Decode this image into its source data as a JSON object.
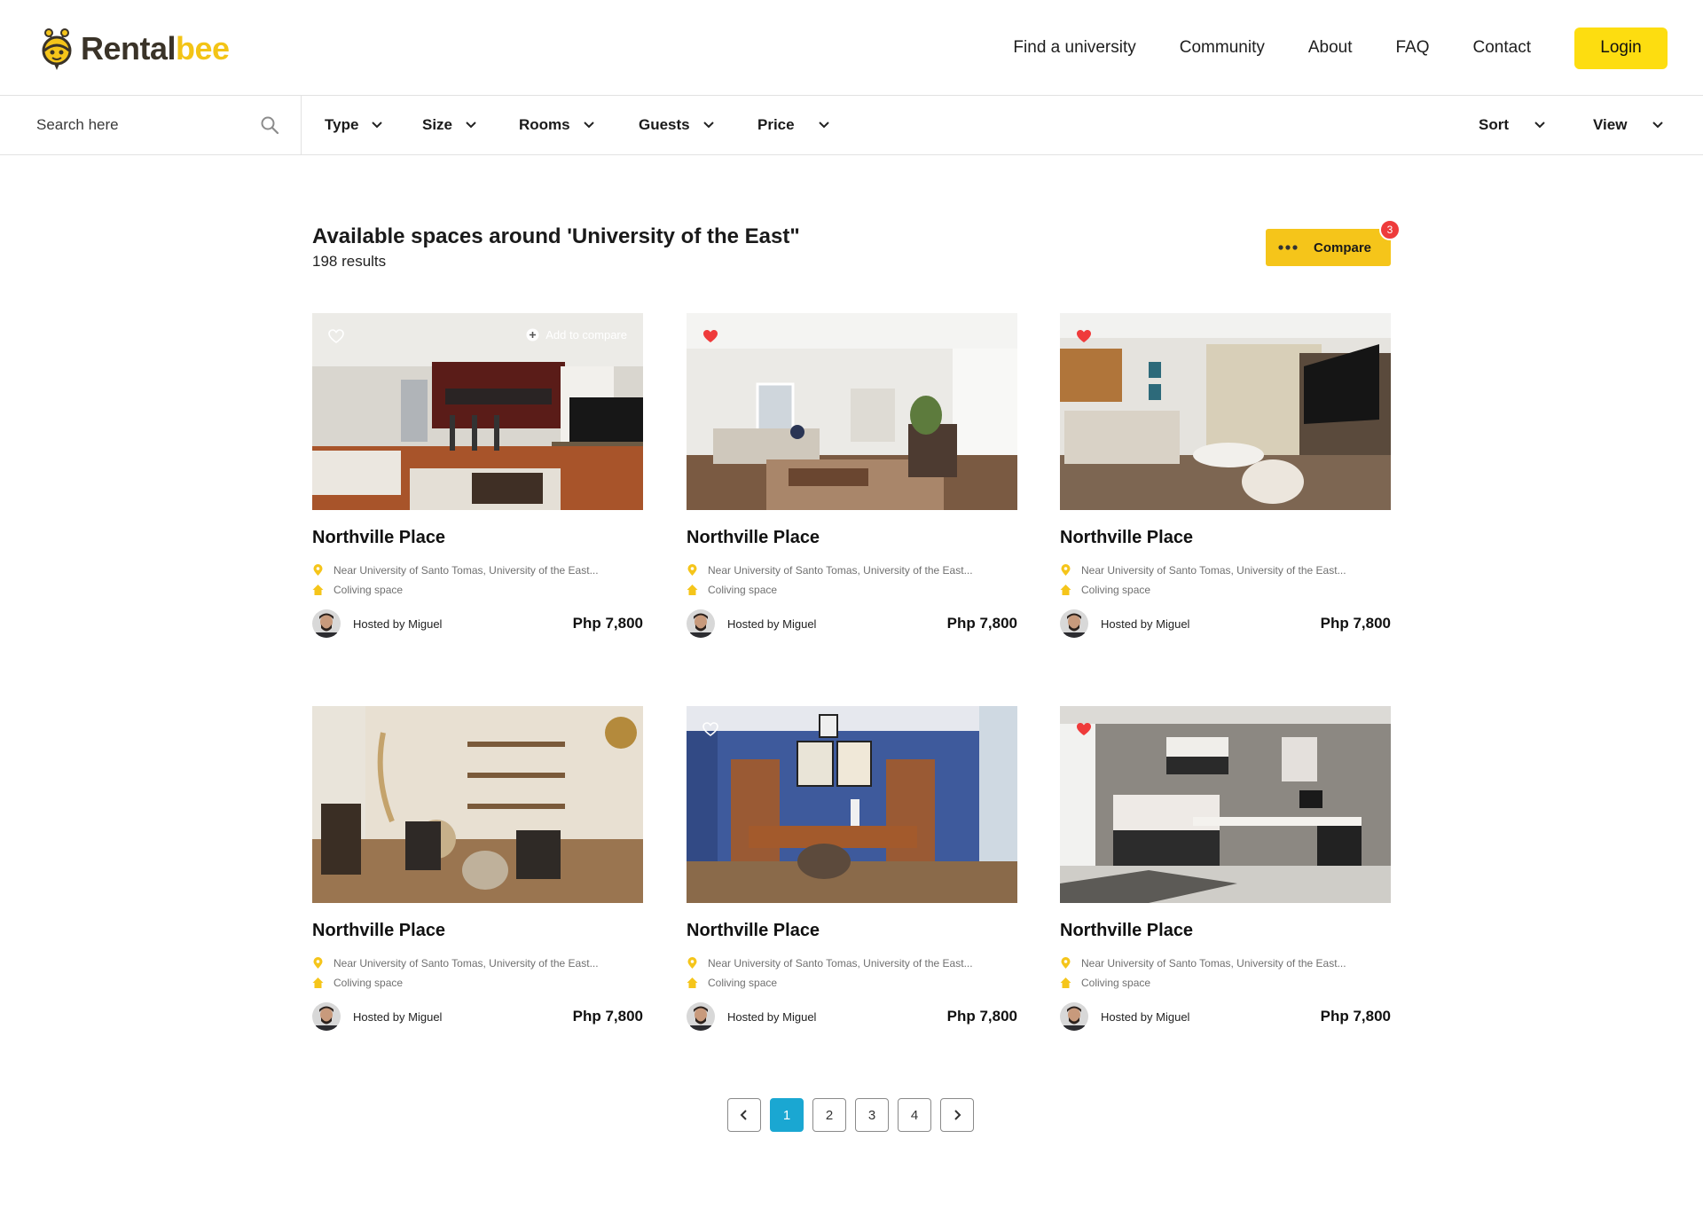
{
  "brand": {
    "name_part1": "Rental",
    "name_part2": "bee",
    "accent_color": "#fddd10"
  },
  "nav": {
    "links": [
      "Find a university",
      "Community",
      "About",
      "FAQ",
      "Contact"
    ],
    "login_label": "Login"
  },
  "filters": {
    "search_placeholder": "Search here",
    "items": [
      "Type",
      "Size",
      "Rooms",
      "Guests",
      "Price"
    ],
    "sort_label": "Sort",
    "view_label": "View"
  },
  "results": {
    "title": "Available spaces around 'University of the East\"",
    "count": "198 results",
    "compare_label": "Compare",
    "compare_count": "3"
  },
  "cards": [
    {
      "title": "Northville Place",
      "location": "Near University of Santo Tomas, University of the East...",
      "type": "Coliving space",
      "host": "Hosted by Miguel",
      "price": "Php 7,800",
      "favorited": false,
      "add_compare": "Add to compare",
      "image": "living-room-kitchen"
    },
    {
      "title": "Northville Place",
      "location": "Near University of Santo Tomas, University of the East...",
      "type": "Coliving space",
      "host": "Hosted by Miguel",
      "price": "Php 7,800",
      "favorited": true,
      "image": "living-room-bright"
    },
    {
      "title": "Northville Place",
      "location": "Near University of Santo Tomas, University of the East...",
      "type": "Coliving space",
      "host": "Hosted by Miguel",
      "price": "Php 7,800",
      "favorited": true,
      "image": "living-room-tv"
    },
    {
      "title": "Northville Place",
      "location": "Near University of Santo Tomas, University of the East...",
      "type": "Coliving space",
      "host": "Hosted by Miguel",
      "price": "Php 7,800",
      "favorited": false,
      "image": "boho-lounge"
    },
    {
      "title": "Northville Place",
      "location": "Near University of Santo Tomas, University of the East...",
      "type": "Coliving space",
      "host": "Hosted by Miguel",
      "price": "Php 7,800",
      "favorited": false,
      "image": "blue-office"
    },
    {
      "title": "Northville Place",
      "location": "Near University of Santo Tomas, University of the East...",
      "type": "Coliving space",
      "host": "Hosted by Miguel",
      "price": "Php 7,800",
      "favorited": true,
      "image": "bedroom-desk"
    }
  ],
  "pagination": {
    "pages": [
      "1",
      "2",
      "3",
      "4"
    ],
    "current": "1"
  },
  "icons": {
    "search": "search-icon",
    "chevron": "chevron-down-icon",
    "heart": "heart-icon",
    "pin": "location-pin-icon",
    "home": "home-icon",
    "prev": "chevron-left-icon",
    "next": "chevron-right-icon"
  },
  "colors": {
    "favorite": "#ef3b3b",
    "meta_icon": "#f5c51a",
    "page_active": "#1aa7d2",
    "badge": "#ee3b3b"
  }
}
